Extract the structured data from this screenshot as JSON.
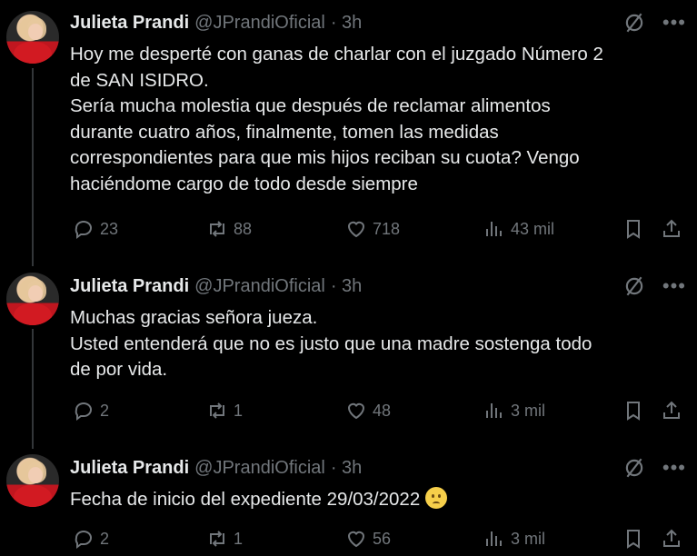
{
  "tweets": [
    {
      "name": "Julieta Prandi",
      "handle": "@JPrandiOficial",
      "time": "· 3h",
      "lines": [
        "Hoy me desperté con ganas de charlar con el juzgado Número 2",
        "de SAN ISIDRO.",
        "Sería mucha molestia que después de reclamar alimentos",
        "durante cuatro años, finalmente, tomen las medidas",
        "correspondientes para que mis hijos reciban su cuota? Vengo",
        "haciéndome cargo de todo desde siempre"
      ],
      "replies": "23",
      "retweets": "88",
      "likes": "718",
      "views": "43 mil"
    },
    {
      "name": "Julieta Prandi",
      "handle": "@JPrandiOficial",
      "time": "· 3h",
      "lines": [
        "Muchas gracias señora jueza.",
        "Usted entenderá que no es justo que una madre sostenga todo",
        "de por vida."
      ],
      "replies": "2",
      "retweets": "1",
      "likes": "48",
      "views": "3 mil"
    },
    {
      "name": "Julieta Prandi",
      "handle": "@JPrandiOficial",
      "time": "· 3h",
      "lines": [
        "Fecha de inicio del expediente 29/03/2022"
      ],
      "replies": "2",
      "retweets": "1",
      "likes": "56",
      "views": "3 mil"
    }
  ],
  "icons": {
    "grok": "grok-icon",
    "more": "more-icon",
    "reply": "reply-icon",
    "retweet": "retweet-icon",
    "like": "like-icon",
    "views": "views-icon",
    "bookmark": "bookmark-icon",
    "share": "share-icon",
    "emoji": "confused-face-emoji"
  },
  "colors": {
    "background": "#000000",
    "text": "#e7e9ea",
    "muted": "#71767b"
  }
}
